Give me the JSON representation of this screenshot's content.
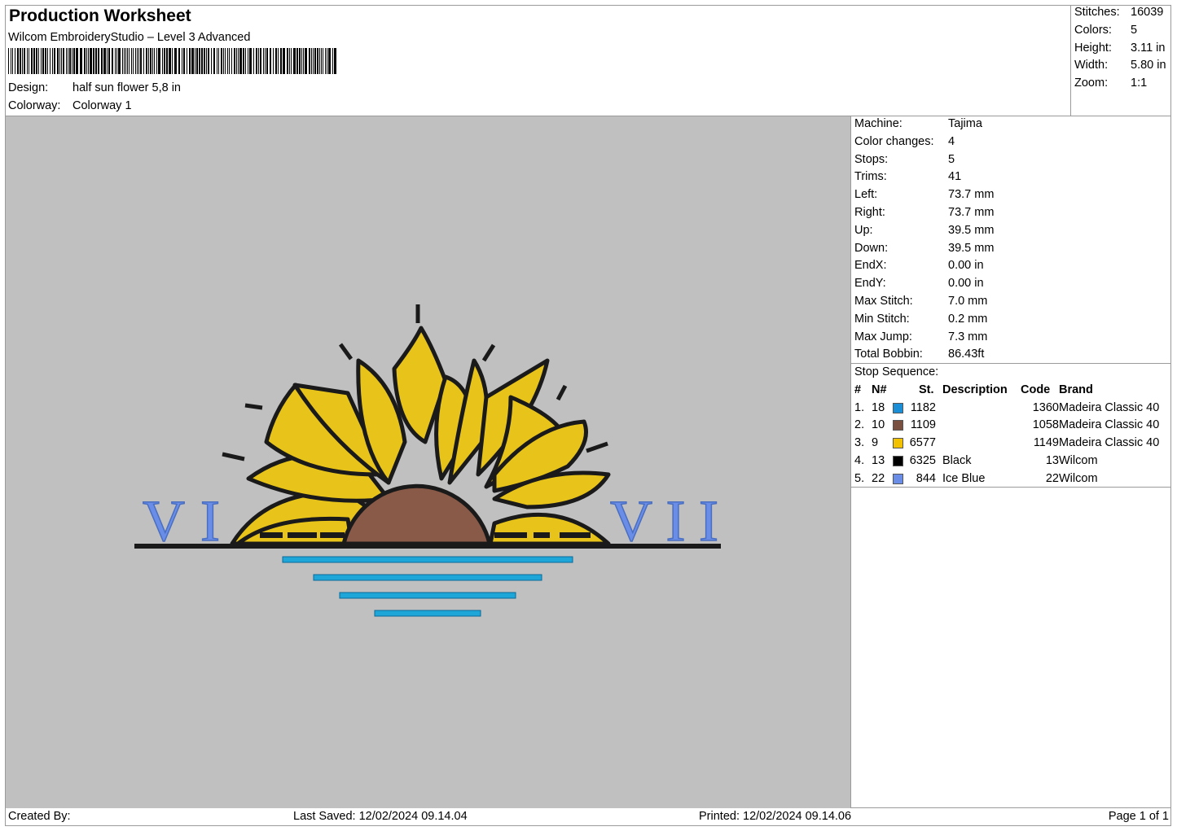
{
  "header": {
    "title": "Production Worksheet",
    "software": "Wilcom EmbroideryStudio – Level 3 Advanced",
    "design_label": "Design:",
    "design_value": "half sun flower 5,8 in",
    "colorway_label": "Colorway:",
    "colorway_value": "Colorway 1"
  },
  "summary": [
    {
      "label": "Stitches:",
      "value": "16039"
    },
    {
      "label": "Colors:",
      "value": "5"
    },
    {
      "label": "Height:",
      "value": "3.11 in"
    },
    {
      "label": "Width:",
      "value": "5.80 in"
    },
    {
      "label": "Zoom:",
      "value": "1:1"
    }
  ],
  "machine_info": [
    {
      "label": "Machine:",
      "value": "Tajima"
    },
    {
      "label": "Color changes:",
      "value": "4"
    },
    {
      "label": "Stops:",
      "value": "5"
    },
    {
      "label": "Trims:",
      "value": "41"
    },
    {
      "label": "Left:",
      "value": "73.7 mm"
    },
    {
      "label": "Right:",
      "value": "73.7 mm"
    },
    {
      "label": "Up:",
      "value": "39.5 mm"
    },
    {
      "label": "Down:",
      "value": "39.5 mm"
    },
    {
      "label": "EndX:",
      "value": "0.00 in"
    },
    {
      "label": "EndY:",
      "value": "0.00 in"
    },
    {
      "label": "Max Stitch:",
      "value": "7.0 mm"
    },
    {
      "label": "Min Stitch:",
      "value": "0.2 mm"
    },
    {
      "label": "Max Jump:",
      "value": "7.3 mm"
    },
    {
      "label": "Total Bobbin:",
      "value": "86.43ft"
    }
  ],
  "stop_sequence": {
    "title": "Stop Sequence:",
    "headers": {
      "idx": "#",
      "n": "N#",
      "st": "St.",
      "description": "Description",
      "code": "Code",
      "brand": "Brand"
    },
    "rows": [
      {
        "idx": "1.",
        "n": "18",
        "color": "#1a8fd8",
        "st": "1182",
        "description": "",
        "code": "1360",
        "brand": "Madeira Classic 40"
      },
      {
        "idx": "2.",
        "n": "10",
        "color": "#7a5040",
        "st": "1109",
        "description": "",
        "code": "1058",
        "brand": "Madeira Classic 40"
      },
      {
        "idx": "3.",
        "n": "9",
        "color": "#f2c200",
        "st": "6577",
        "description": "",
        "code": "1149",
        "brand": "Madeira Classic 40"
      },
      {
        "idx": "4.",
        "n": "13",
        "color": "#000000",
        "st": "6325",
        "description": "Black",
        "code": "13",
        "brand": "Wilcom"
      },
      {
        "idx": "5.",
        "n": "22",
        "color": "#6a8ee8",
        "st": "844",
        "description": "Ice Blue",
        "code": "22",
        "brand": "Wilcom"
      }
    ]
  },
  "design_text": {
    "left": "VI",
    "right": "VII"
  },
  "colors": {
    "canvas": "#c0c0c0",
    "petal": "#e8c41a",
    "center": "#8a5a48",
    "outline": "#1a1a1a",
    "lines": "#1ea6d8",
    "numerals": "#6a8ee8"
  },
  "footer": {
    "created_by": "Created By:",
    "last_saved": "Last Saved: 12/02/2024 09.14.04",
    "printed": "Printed: 12/02/2024 09.14.06",
    "page": "Page 1 of 1"
  }
}
